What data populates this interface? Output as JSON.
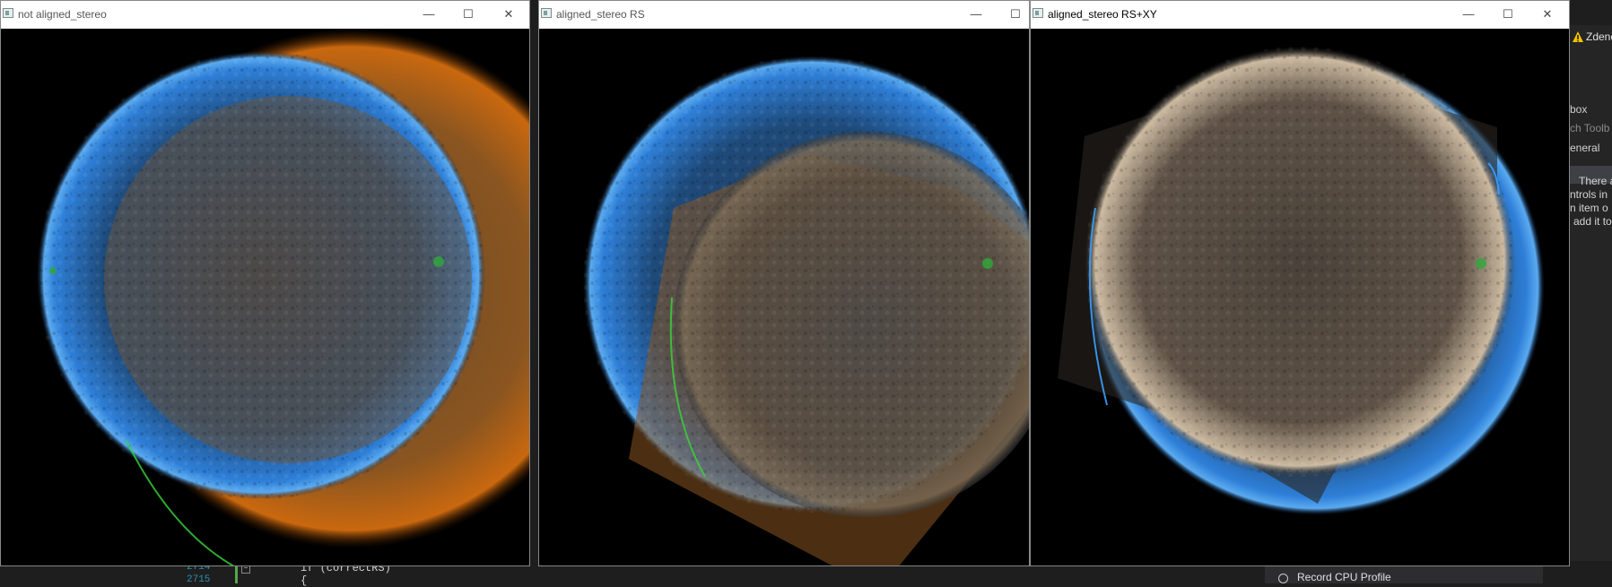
{
  "windows": [
    {
      "title": "not aligned_stereo",
      "minimize_icon": "minimize-icon",
      "maximize_icon": "maximize-icon",
      "close_icon": "close-icon"
    },
    {
      "title": "aligned_stereo RS",
      "minimize_icon": "minimize-icon",
      "maximize_icon": "maximize-icon"
    },
    {
      "title": "aligned_stereo RS+XY",
      "minimize_icon": "minimize-icon",
      "maximize_icon": "maximize-icon",
      "close_icon": "close-icon"
    }
  ],
  "ide": {
    "warning_user": "Zdeně",
    "toolbox_label": "box",
    "search_toolbox": "ch Toolb",
    "general_tab": "eneral",
    "info_lines": [
      "There a",
      "ntrols in",
      "n item o",
      "add it to"
    ],
    "line_numbers": [
      "2714",
      "2715"
    ],
    "code_line": "if (correctRS)",
    "code_brace": "{",
    "record_cpu_profile": "Record CPU Profile"
  },
  "colors": {
    "blue_sun": "#2a7fd4",
    "orange_sun": "#c9680f",
    "gray_sun": "#7a6c5c"
  }
}
